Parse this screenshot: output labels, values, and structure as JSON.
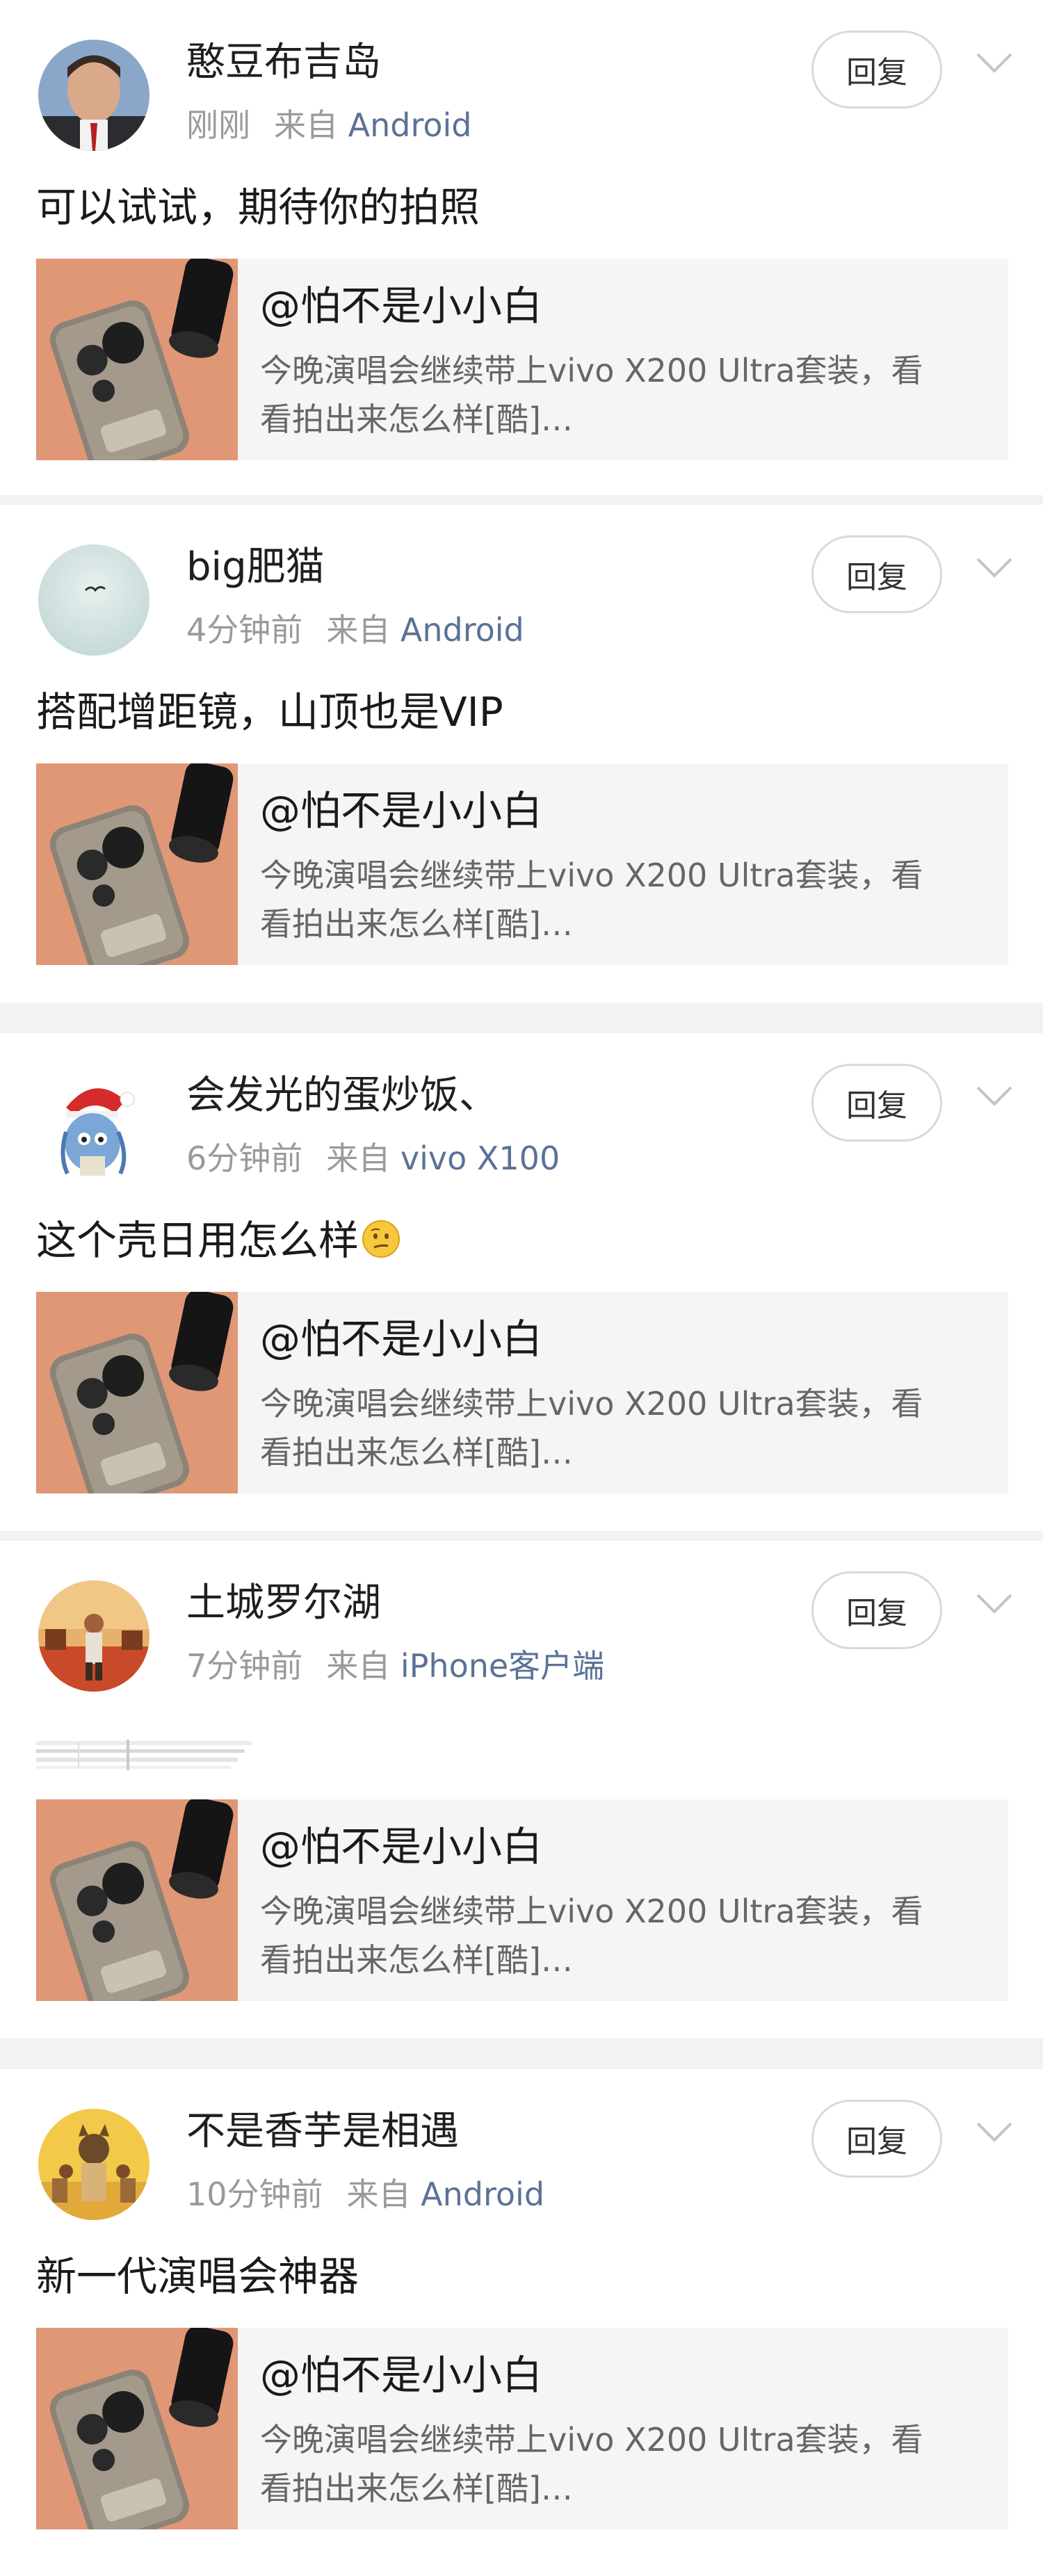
{
  "reply_label": "回复",
  "from_label": "来自",
  "quote": {
    "author": "@怕不是小小白",
    "line1": "今晚演唱会继续带上vivo X200 Ultra套装，看",
    "line2": "看拍出来怎么样[酷]…"
  },
  "comments": [
    {
      "username": "憨豆布吉岛",
      "time": "刚刚",
      "source": "Android",
      "text": "可以试试，期待你的拍照"
    },
    {
      "username": "big肥猫",
      "time": "4分钟前",
      "source": "Android",
      "text": "搭配增距镜，山顶也是VIP"
    },
    {
      "username": "会发光的蛋炒饭、",
      "time": "6分钟前",
      "source": "vivo X100",
      "text": "这个壳日用怎么样",
      "emoji": "thinking-face-emoji"
    },
    {
      "username": "土城罗尔湖",
      "time": "7分钟前",
      "source": "iPhone客户端",
      "text": ""
    },
    {
      "username": "不是香芋是相遇",
      "time": "10分钟前",
      "source": "Android",
      "text": "新一代演唱会神器"
    }
  ],
  "colors": {
    "background": "#f2f2f2",
    "card": "#ffffff",
    "quote_bg": "#f5f5f5",
    "source_link": "#5b7296",
    "meta_gray": "#9a9a9a"
  }
}
